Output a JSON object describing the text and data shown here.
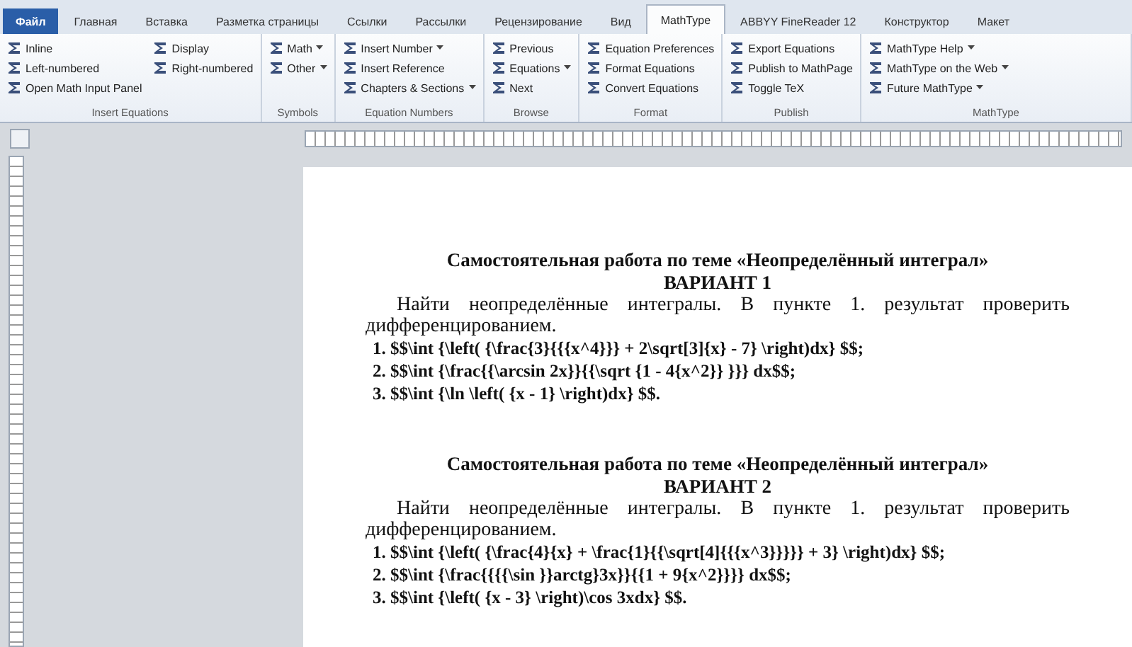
{
  "tabs": [
    {
      "label": "Файл",
      "selected": false,
      "kind": "file"
    },
    {
      "label": "Главная",
      "selected": false,
      "kind": "tab"
    },
    {
      "label": "Вставка",
      "selected": false,
      "kind": "tab"
    },
    {
      "label": "Разметка страницы",
      "selected": false,
      "kind": "tab"
    },
    {
      "label": "Ссылки",
      "selected": false,
      "kind": "tab"
    },
    {
      "label": "Рассылки",
      "selected": false,
      "kind": "tab"
    },
    {
      "label": "Рецензирование",
      "selected": false,
      "kind": "tab"
    },
    {
      "label": "Вид",
      "selected": false,
      "kind": "tab"
    },
    {
      "label": "MathType",
      "selected": true,
      "kind": "tab"
    },
    {
      "label": "ABBYY FineReader 12",
      "selected": false,
      "kind": "tab"
    },
    {
      "label": "Конструктор",
      "selected": false,
      "kind": "tab"
    },
    {
      "label": "Макет",
      "selected": false,
      "kind": "tab"
    }
  ],
  "ribbon_groups": [
    {
      "title": "Insert Equations",
      "commands": [
        {
          "label": "Inline",
          "dropdown": false
        },
        {
          "label": "Left-numbered",
          "dropdown": false
        },
        {
          "label": "Open Math Input Panel",
          "dropdown": false
        },
        {
          "label": "Display",
          "dropdown": false
        },
        {
          "label": "Right-numbered",
          "dropdown": false
        }
      ]
    },
    {
      "title": "Symbols",
      "commands": [
        {
          "label": "Math",
          "dropdown": true
        },
        {
          "label": "Other",
          "dropdown": true
        }
      ]
    },
    {
      "title": "Equation Numbers",
      "commands": [
        {
          "label": "Insert Number",
          "dropdown": true
        },
        {
          "label": "Insert Reference",
          "dropdown": false
        },
        {
          "label": "Chapters & Sections",
          "dropdown": true
        }
      ]
    },
    {
      "title": "Browse",
      "commands": [
        {
          "label": "Previous",
          "dropdown": false
        },
        {
          "label": "Equations",
          "dropdown": true
        },
        {
          "label": "Next",
          "dropdown": false
        }
      ]
    },
    {
      "title": "Format",
      "commands": [
        {
          "label": "Equation Preferences",
          "dropdown": false
        },
        {
          "label": "Format Equations",
          "dropdown": false
        },
        {
          "label": "Convert Equations",
          "dropdown": false
        }
      ]
    },
    {
      "title": "Publish",
      "commands": [
        {
          "label": "Export Equations",
          "dropdown": false
        },
        {
          "label": "Publish to MathPage",
          "dropdown": false
        },
        {
          "label": "Toggle TeX",
          "dropdown": false
        }
      ]
    },
    {
      "title": "MathType",
      "commands": [
        {
          "label": "MathType Help",
          "dropdown": true
        },
        {
          "label": "MathType on the Web",
          "dropdown": true
        },
        {
          "label": "Future MathType",
          "dropdown": true
        }
      ]
    }
  ],
  "document": {
    "sections": [
      {
        "title": "Самостоятельная работа по теме «Неопределённый интеграл»",
        "variant": "ВАРИАНТ 1",
        "instruction": "Найти неопределённые интегралы. В пункте 1. результат проверить дифференцированием.",
        "items": [
          "1. $$\\int {\\left( {\\frac{3}{{{x^4}}} + 2\\sqrt[3]{x} - 7} \\right)dx} $$;",
          "2. $$\\int {\\frac{{\\arcsin 2x}}{{\\sqrt {1 - 4{x^2}} }}} dx$$;",
          "3. $$\\int {\\ln \\left( {x - 1} \\right)dx} $$."
        ]
      },
      {
        "title": "Самостоятельная работа по теме «Неопределённый интеграл»",
        "variant": "ВАРИАНТ 2",
        "instruction": "Найти неопределённые интегралы. В пункте 1. результат проверить дифференцированием.",
        "items": [
          "1. $$\\int {\\left( {\\frac{4}{x} + \\frac{1}{{\\sqrt[4]{{{x^3}}}}} + 3} \\right)dx} $$;",
          "2. $$\\int {\\frac{{{{\\sin }}arctg}3x}}{{1 + 9{x^2}}}} dx$$;",
          "3. $$\\int {\\left( {x - 3} \\right)\\cos 3xdx} $$."
        ]
      }
    ]
  }
}
